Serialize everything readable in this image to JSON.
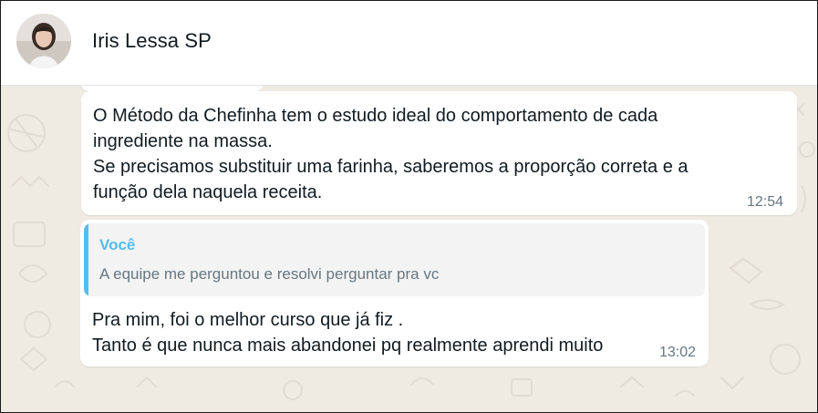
{
  "contact": {
    "name": "Iris Lessa SP",
    "avatar_icon": "profile-photo"
  },
  "messages": [
    {
      "text": "O Método da Chefinha tem o estudo ideal do comportamento de cada\ningrediente na massa.\nSe precisamos substituir uma farinha, saberemos a proporção correta e a\nfunção dela naquela receita.",
      "time": "12:54"
    },
    {
      "quote": {
        "author": "Você",
        "text": "A equipe me perguntou e resolvi perguntar pra vc"
      },
      "text": "Pra mim, foi o melhor curso que já fiz .\nTanto é que nunca mais abandonei pq realmente aprendi muito",
      "time": "13:02"
    }
  ],
  "colors": {
    "chat_background": "#efeae2",
    "bubble": "#ffffff",
    "quote_accent": "#53bdeb",
    "timestamp": "#667781"
  }
}
